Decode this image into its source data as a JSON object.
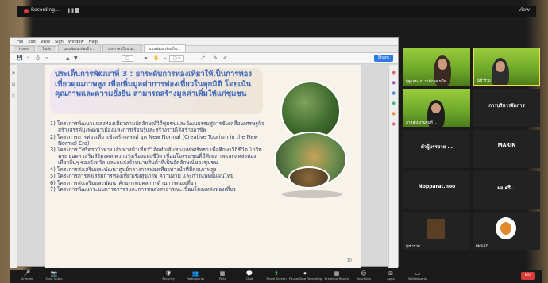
{
  "zoom_top": {
    "recording_label": "Recording...",
    "view_label": "View"
  },
  "pdf": {
    "menu": [
      "File",
      "Edit",
      "View",
      "Sign",
      "Window",
      "Help"
    ],
    "tabs": [
      "Home",
      "Tools",
      "แผนพัฒนาท้องถิ่น...",
      "ประกาศนโยบาย...",
      "แผนพัฒนาท้องถิ่น..."
    ],
    "share_label": "Share"
  },
  "slide": {
    "title": "ประเด็นการพัฒนาที่ 3 : ยกระดับการท่องเที่ยวให้เป็นการท่องเที่ยวคุณภาพสูง เพื่อเพิ่มมูลค่าการท่องเที่ยวในทุกมิติ โดยเน้นคุณภาพและความยั่งยืน สามารถสร้างมูลค่าเพิ่มให้แก่ชุมชน",
    "items": [
      "1) โครงการพัฒนาแหล่งท่องเที่ยวตามอัตลักษณ์วิถีชุมชนและวัฒนธรรมสู่การขับเคลื่อนเศรษฐกิจสร้างสรรค์มุ่งพัฒนาเมืองแห่งการเรียนรู้และสร้างรายได้สร้างอาชีพ",
      "2) โครงการการท่องเที่ยวเชิงสร้างสรรค์ ยุค New Normal (Creative Tourism in the New Normal Era)",
      "3) โครงการ \"ศรีตราบ้าทาง เส้นทางนำเที่ยว\" จัดทำเส้นทางแห่งศรัทธา เพื่อศึกษาวิถีชีวิต โกวิทพระ ยอดฯ เสริมสิริมงคล ความรุ่งเรืองแห่งชีวิต เชื่อมโยงชุมชนที่มีศักยภาพและแหล่งท่องเที่ยวอื่นๆ ของจังหวัด และแหล่งจำหน่ายสินค้าที่เป็นอัตลักษณ์ของชุมชน",
      "4) โครงการส่งเสริมและพัฒนาศูนย์กลางการท่องเที่ยวทางน้ำที่มีคุณภาพสูง",
      "5) โครงการการส่งเสริมการท่องเที่ยวเชิงสุขภาพ ความงาม และการแพทย์แผนไทย",
      "6) โครงการส่งเสริมและพัฒนาศักยภาพบุคลากรด้านการท่องเที่ยว",
      "7) โครงการพัฒนาระบบการจราจรและการขนส่งสาธารณะเชื่อมโยงแหล่งท่องเที่ยว"
    ],
    "page_number": "30"
  },
  "gallery": [
    {
      "name": "ผู้ดูแลระบบ ภาคีภาคเหนือ",
      "type": "video"
    },
    {
      "name": "ผู้เข้าร่วม",
      "type": "video"
    },
    {
      "name": "ภาคส่วนงานคนที่ ...",
      "type": "video"
    },
    {
      "name": "การบริหารจัดการ",
      "type": "name"
    },
    {
      "name": "ตัวผู้บรรยาย ...",
      "type": "name"
    },
    {
      "name": "MARIN",
      "type": "name"
    },
    {
      "name": "Nopparat.noo",
      "type": "name"
    },
    {
      "name": "ผอ.ศรี...",
      "type": "name"
    },
    {
      "name": "ผู้เข้าร่วม",
      "type": "video"
    },
    {
      "name": "PMSBT",
      "type": "video"
    }
  ],
  "controls": [
    {
      "icon": "mic-icon",
      "glyph": "🎤",
      "label": "Unmute"
    },
    {
      "icon": "video-icon",
      "glyph": "📷",
      "label": "Start Video"
    },
    {
      "icon": "security-icon",
      "glyph": "🛡",
      "label": "Security"
    },
    {
      "icon": "participants-icon",
      "glyph": "👥",
      "label": "Participants"
    },
    {
      "icon": "polls-icon",
      "glyph": "▦",
      "label": "Polls"
    },
    {
      "icon": "chat-icon",
      "glyph": "💬",
      "label": "Chat"
    },
    {
      "icon": "share-screen-icon",
      "glyph": "⬆",
      "label": "Share Screen"
    },
    {
      "icon": "record-icon",
      "glyph": "⏺",
      "label": "Pause/Stop Recording"
    },
    {
      "icon": "breakout-icon",
      "glyph": "▦",
      "label": "Breakout Rooms"
    },
    {
      "icon": "reactions-icon",
      "glyph": "☺",
      "label": "Reactions"
    },
    {
      "icon": "apps-icon",
      "glyph": "⊞",
      "label": "Apps"
    },
    {
      "icon": "whiteboard-icon",
      "glyph": "▭",
      "label": "Whiteboards"
    }
  ],
  "end_label": "End"
}
